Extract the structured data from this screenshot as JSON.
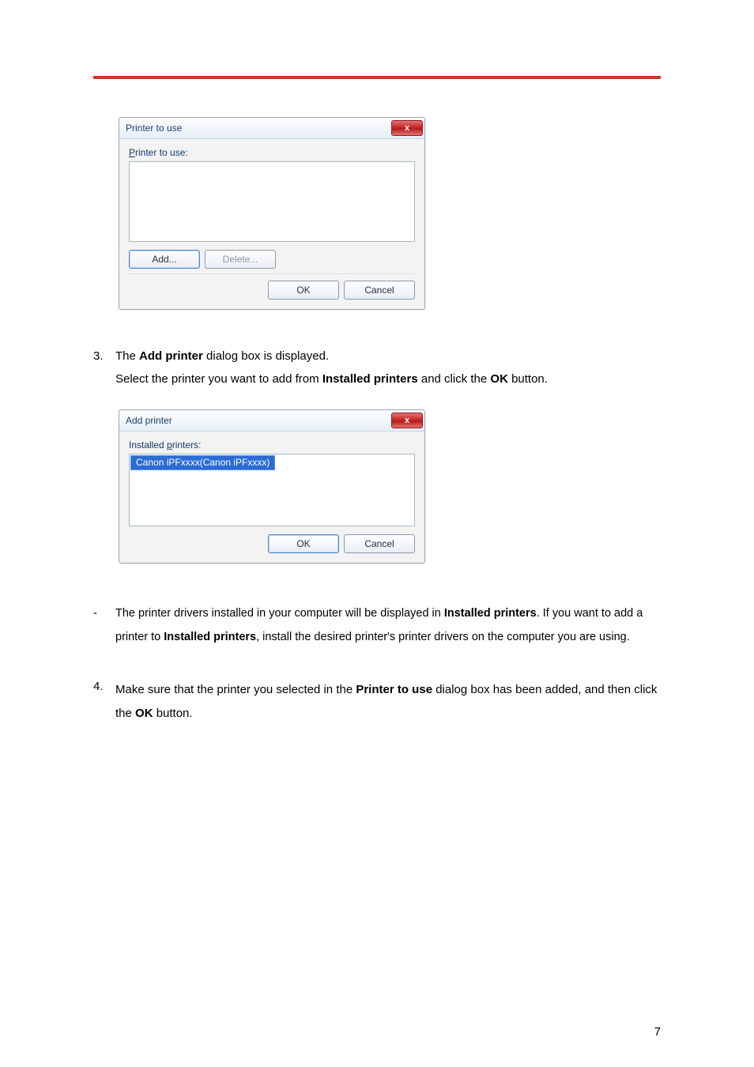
{
  "dialog1": {
    "title": "Printer to use",
    "label_pre": "P",
    "label_rest": "rinter to use:",
    "add_pre": "A",
    "add_rest": "dd...",
    "del_pre": "D",
    "del_rest": "elete...",
    "ok": "OK",
    "cancel": "Cancel",
    "close_glyph": "x"
  },
  "dialog2": {
    "title": "Add printer",
    "label_a": "Installed ",
    "label_pre": "p",
    "label_rest": "rinters:",
    "selected_item": "Canon iPFxxxx(Canon iPFxxxx)",
    "ok": "OK",
    "cancel": "Cancel",
    "close_glyph": "x"
  },
  "step3": {
    "num": "3.",
    "line1_a": "The ",
    "line1_b": "Add printer",
    "line1_c": " dialog box is displayed.",
    "line2_a": "Select the printer you want to add from ",
    "line2_b": "Installed printers",
    "line2_c": " and click the ",
    "line2_d": "OK",
    "line2_e": " button."
  },
  "note": {
    "dash": "-",
    "a": "The printer drivers installed in your computer will be displayed in ",
    "b": "Installed printers",
    "c": ". If you want to add a printer to ",
    "d": "Installed printers",
    "e": ", install the desired printer's printer drivers on the computer you are using."
  },
  "step4": {
    "num": "4.",
    "a": "Make sure that the printer you selected in the ",
    "b": "Printer to use",
    "c": " dialog box has been added, and then click the ",
    "d": "OK",
    "e": " button."
  },
  "page_number": "7"
}
